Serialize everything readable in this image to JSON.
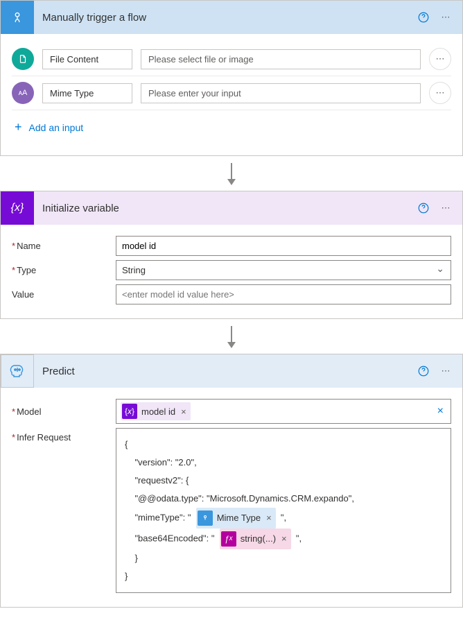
{
  "trigger": {
    "title": "Manually trigger a flow",
    "rows": [
      {
        "icon": "file-icon",
        "label": "File Content",
        "placeholder": "Please select file or image"
      },
      {
        "icon": "text-icon",
        "label": "Mime Type",
        "placeholder": "Please enter your input"
      }
    ],
    "addInput": "Add an input"
  },
  "initVar": {
    "title": "Initialize variable",
    "nameLabel": "Name",
    "nameValue": "model id",
    "typeLabel": "Type",
    "typeValue": "String",
    "valueLabel": "Value",
    "valuePlaceholder": "<enter model id value here>"
  },
  "predict": {
    "title": "Predict",
    "modelLabel": "Model",
    "modelToken": "model id",
    "inferLabel": "Infer Request",
    "json": {
      "l1": "{",
      "l2": "    \"version\": \"2.0\",",
      "l3": "    \"requestv2\": {",
      "l4": "    \"@@odata.type\": \"Microsoft.Dynamics.CRM.expando\",",
      "l5a": "    \"mimeType\": \" ",
      "l5token": "Mime Type",
      "l5b": " \",",
      "l6a": "    \"base64Encoded\": \" ",
      "l6token": "string(...)",
      "l6b": " \",",
      "l7": "    }",
      "l8": "}"
    }
  }
}
